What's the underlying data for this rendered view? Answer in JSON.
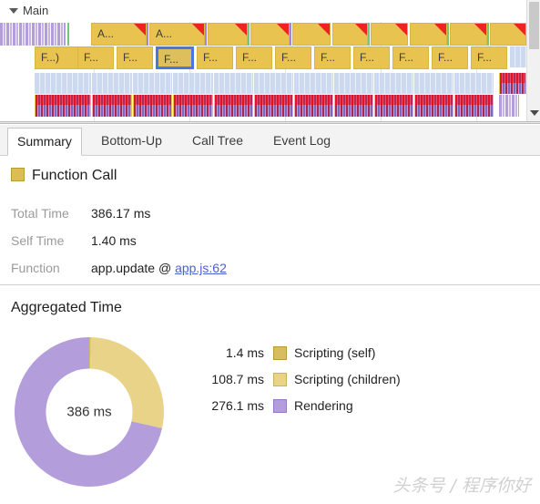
{
  "flame": {
    "track_name": "Main",
    "collapse_icon": "triangle-down-icon",
    "scrollbar_down_icon": "chevron-down-icon",
    "row1_blocks": [
      {
        "label": "A...",
        "warn": true
      },
      {
        "label": "A...",
        "warn": true
      },
      {
        "label": "",
        "warn": true
      },
      {
        "label": "",
        "warn": true
      },
      {
        "label": "",
        "warn": true
      },
      {
        "label": "",
        "warn": true
      },
      {
        "label": "",
        "warn": true
      },
      {
        "label": "",
        "warn": true
      },
      {
        "label": "",
        "warn": true
      },
      {
        "label": "",
        "warn": true
      },
      {
        "label": "",
        "warn": true
      },
      {
        "label": "",
        "warn": false
      }
    ],
    "row2_blocks": [
      {
        "label": "F...)",
        "selected": false
      },
      {
        "label": "F...",
        "selected": false
      },
      {
        "label": "F...",
        "selected": false
      },
      {
        "label": "F...",
        "selected": true
      },
      {
        "label": "F...",
        "selected": false
      },
      {
        "label": "F...",
        "selected": false
      },
      {
        "label": "F...",
        "selected": false
      },
      {
        "label": "F...",
        "selected": false
      },
      {
        "label": "F...",
        "selected": false
      },
      {
        "label": "F...",
        "selected": false
      },
      {
        "label": "F...",
        "selected": false
      },
      {
        "label": "F...",
        "selected": false
      }
    ],
    "colors": {
      "scripting": "#e8c350",
      "scripting_border": "#d9b63f",
      "selected_border": "#4a76e0",
      "warning_marker": "#ee2222",
      "loading": "#ccd9ef",
      "rendering": "#b39ddb",
      "painting": "#ef3b5c",
      "gc_green": "#79c47b"
    }
  },
  "tabs": [
    {
      "label": "Summary",
      "active": true
    },
    {
      "label": "Bottom-Up",
      "active": false
    },
    {
      "label": "Call Tree",
      "active": false
    },
    {
      "label": "Event Log",
      "active": false
    }
  ],
  "summary": {
    "event_name": "Function Call",
    "event_color": "#dcbd52",
    "total_time_label": "Total Time",
    "total_time_value": "386.17 ms",
    "self_time_label": "Self Time",
    "self_time_value": "1.40 ms",
    "function_label": "Function",
    "function_value": "app.update @",
    "function_link": "app.js:62"
  },
  "aggregated": {
    "title": "Aggregated Time",
    "center_label": "386 ms",
    "legend": [
      {
        "value": "1.4 ms",
        "name": "Scripting (self)",
        "color": "#d9bc5f",
        "border": "#b99b33"
      },
      {
        "value": "108.7 ms",
        "name": "Scripting (children)",
        "color": "#e8d389",
        "border": "#cdb35f"
      },
      {
        "value": "276.1 ms",
        "name": "Rendering",
        "color": "#b39ddb",
        "border": "#9479c9"
      }
    ]
  },
  "chart_data": {
    "type": "pie",
    "title": "Aggregated Time",
    "center_label": "386 ms",
    "unit": "ms",
    "total": 386.2,
    "inner_radius_ratio": 0.58,
    "start_angle_deg": 0,
    "legend_position": "right",
    "categories": [
      "Scripting (self)",
      "Scripting (children)",
      "Rendering"
    ],
    "values": [
      1.4,
      108.7,
      276.1
    ],
    "colors": [
      "#d9bc5f",
      "#e8d389",
      "#b39ddb"
    ],
    "percentages": [
      0.36,
      28.15,
      71.49
    ],
    "angles_deg": [
      1.3,
      101.3,
      257.4
    ]
  },
  "watermark": "头条号 / 程序你好"
}
